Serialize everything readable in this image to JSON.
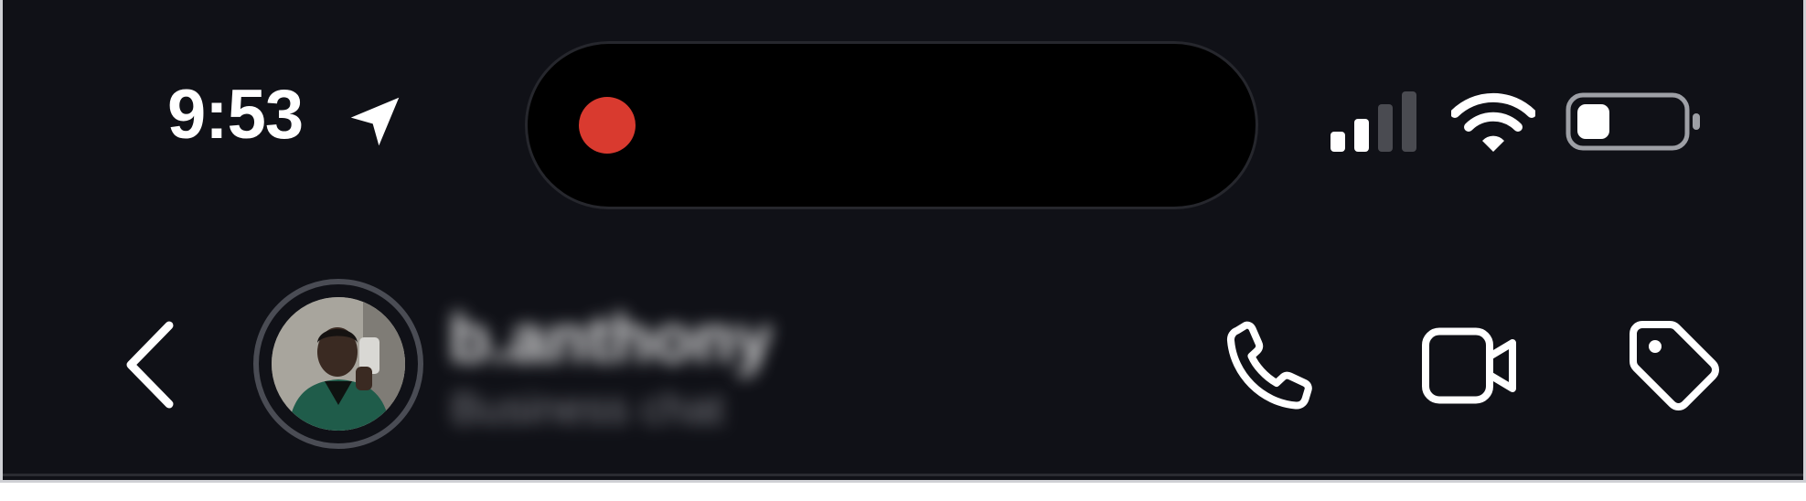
{
  "status_bar": {
    "time": "9:53",
    "location_icon": "location-arrow-icon",
    "recording_indicator_color": "#d93a2f",
    "signal_icon": "cellular-signal-icon",
    "signal_bars_active": 2,
    "signal_bars_total": 4,
    "wifi_icon": "wifi-icon",
    "battery_icon": "battery-icon",
    "battery_level": 0.15
  },
  "header": {
    "back_icon": "chevron-left-icon",
    "contact_name": "b.anthony",
    "contact_subtitle": "Business chat",
    "actions": {
      "call_icon": "phone-icon",
      "video_icon": "video-camera-icon",
      "label_icon": "tag-icon"
    }
  },
  "colors": {
    "background": "#101117",
    "foreground": "#ffffff",
    "recording_dot": "#d93a2f"
  }
}
